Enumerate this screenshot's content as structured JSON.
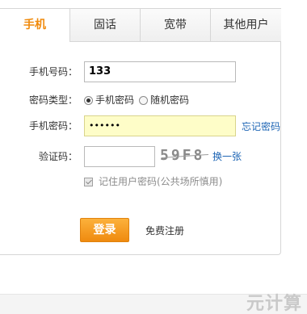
{
  "tabs": [
    {
      "label": "手机",
      "active": true
    },
    {
      "label": "固话",
      "active": false
    },
    {
      "label": "宽带",
      "active": false
    },
    {
      "label": "其他用户",
      "active": false
    }
  ],
  "form": {
    "phone_label": "手机号码：",
    "phone_value": "133",
    "password_type_label": "密码类型：",
    "password_type_options": [
      {
        "label": "手机密码",
        "checked": true
      },
      {
        "label": "随机密码",
        "checked": false
      }
    ],
    "password_label": "手机密码：",
    "password_value": "••••••",
    "forgot_password": "忘记密码",
    "captcha_label": "验证码：",
    "captcha_value": "",
    "captcha_image_text": "59F8",
    "refresh_captcha": "换一张",
    "remember_label": "记住用户密码(公共场所慎用)",
    "remember_checked": true
  },
  "actions": {
    "login": "登录",
    "register": "免费注册"
  },
  "watermark": "元计算",
  "colors": {
    "accent": "#f08a0c",
    "link": "#1c64b4",
    "focused_input_bg": "#fefdc8"
  }
}
